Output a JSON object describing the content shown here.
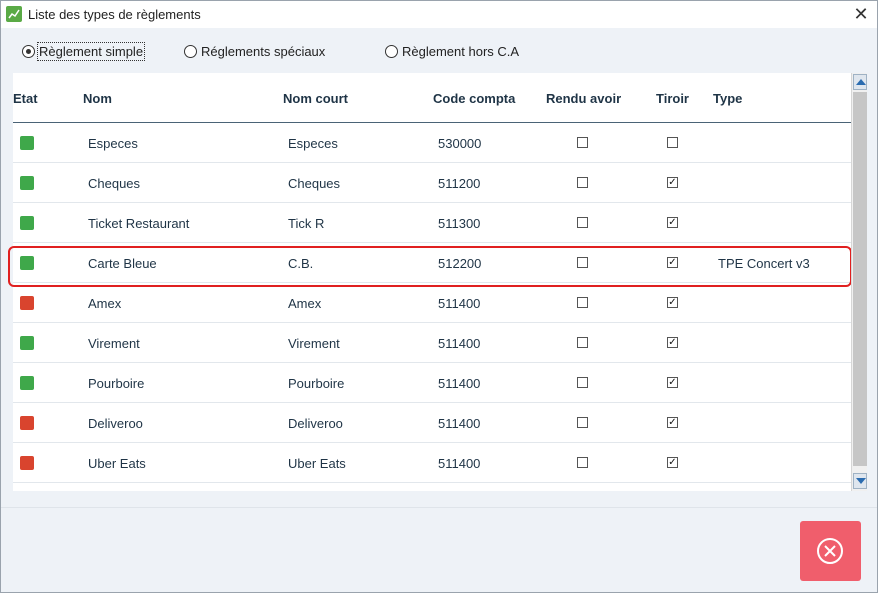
{
  "window": {
    "title": "Liste des types de règlements",
    "close_glyph": "✕"
  },
  "options": [
    {
      "label": "Règlement simple",
      "selected": true
    },
    {
      "label": "Réglements spéciaux",
      "selected": false
    },
    {
      "label": "Règlement hors C.A",
      "selected": false
    }
  ],
  "table": {
    "columns": {
      "etat": "Etat",
      "nom": "Nom",
      "nom_court": "Nom court",
      "code": "Code compta",
      "rendu": "Rendu avoir",
      "tiroir": "Tiroir",
      "type": "Type"
    },
    "rows": [
      {
        "state": "active",
        "nom": "Especes",
        "nom_court": "Especes",
        "code": "530000",
        "rendu": false,
        "tiroir": false,
        "type": ""
      },
      {
        "state": "active",
        "nom": "Cheques",
        "nom_court": "Cheques",
        "code": "511200",
        "rendu": false,
        "tiroir": true,
        "type": ""
      },
      {
        "state": "active",
        "nom": "Ticket Restaurant",
        "nom_court": "Tick R",
        "code": "511300",
        "rendu": false,
        "tiroir": true,
        "type": ""
      },
      {
        "state": "active",
        "nom": "Carte Bleue",
        "nom_court": "C.B.",
        "code": "512200",
        "rendu": false,
        "tiroir": true,
        "type": "TPE Concert v3"
      },
      {
        "state": "inactive",
        "nom": "Amex",
        "nom_court": "Amex",
        "code": "511400",
        "rendu": false,
        "tiroir": true,
        "type": ""
      },
      {
        "state": "active",
        "nom": "Virement",
        "nom_court": "Virement",
        "code": "511400",
        "rendu": false,
        "tiroir": true,
        "type": ""
      },
      {
        "state": "active",
        "nom": "Pourboire",
        "nom_court": "Pourboire",
        "code": "511400",
        "rendu": false,
        "tiroir": true,
        "type": ""
      },
      {
        "state": "inactive",
        "nom": "Deliveroo",
        "nom_court": "Deliveroo",
        "code": "511400",
        "rendu": false,
        "tiroir": true,
        "type": ""
      },
      {
        "state": "inactive",
        "nom": "Uber Eats",
        "nom_court": "Uber Eats",
        "code": "511400",
        "rendu": false,
        "tiroir": true,
        "type": ""
      }
    ]
  },
  "colors": {
    "active_state": "#3fa84a",
    "inactive_state": "#d9442e",
    "highlight": "#e02020",
    "close_button": "#f05e6c"
  },
  "icons": {
    "app": "app-chart-icon",
    "active": "active-state-icon",
    "inactive": "inactive-state-icon",
    "close_dialog": "close-circle-icon"
  }
}
